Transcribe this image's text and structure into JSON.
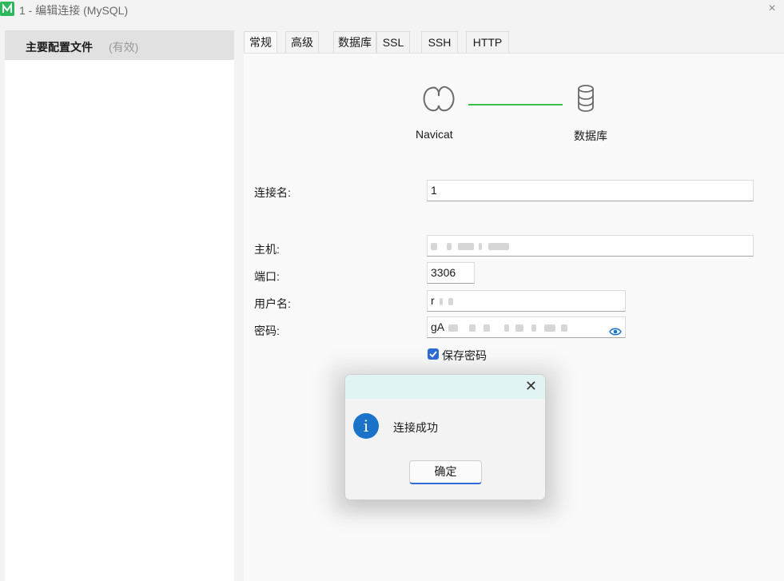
{
  "window": {
    "title": "1 - 编辑连接 (MySQL)",
    "close_glyph": "×",
    "logo_icon": "navicat-logo-icon",
    "logo_color": "#2eb85c"
  },
  "sidebar": {
    "items": [
      {
        "label": "主要配置文件",
        "status": "(有效)",
        "selected": true
      }
    ]
  },
  "tabs": [
    {
      "label": "常规",
      "active": true
    },
    {
      "label": "高级",
      "active": false
    },
    {
      "label": "数据库",
      "active": false
    },
    {
      "label": "SSL",
      "active": false
    },
    {
      "label": "SSH",
      "active": false
    },
    {
      "label": "HTTP",
      "active": false
    }
  ],
  "diagram": {
    "left_label": "Navicat",
    "right_label": "数据库",
    "left_icon": "navicat-icon",
    "right_icon": "database-icon",
    "line_color": "#35c04a"
  },
  "form": {
    "connection_name": {
      "label": "连接名:",
      "value": "1"
    },
    "host": {
      "label": "主机:",
      "value": ""
    },
    "port": {
      "label": "端口:",
      "value": "3306"
    },
    "username": {
      "label": "用户名:",
      "value": "r"
    },
    "password": {
      "label": "密码:",
      "value": "gA",
      "reveal_icon": "eye-icon"
    },
    "save_password": {
      "label": "保存密码",
      "checked": true
    }
  },
  "dialog": {
    "close_glyph": "✕",
    "icon": "info-icon",
    "icon_glyph": "i",
    "message": "连接成功",
    "ok_label": "确定",
    "header_color": "#e2f3f3",
    "accent": "#2f6bd6"
  }
}
